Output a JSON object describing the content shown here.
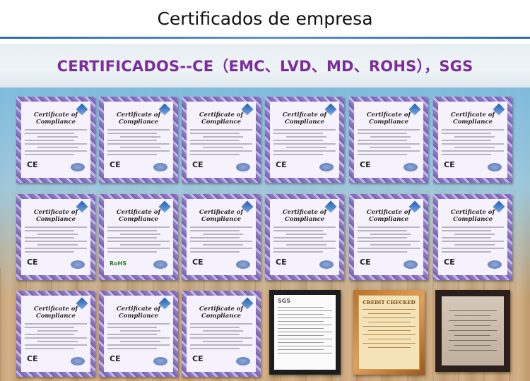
{
  "header": {
    "title": "Certificados de empresa"
  },
  "banner": {
    "text": "CERTIFICADOS--CE（EMC、LVD、MD、ROHS），SGS"
  },
  "certificates": {
    "heading": "Certificate of Compliance",
    "ce_mark": "CE",
    "rohs_mark": "RoHS"
  },
  "framed": {
    "sgs_logo": "SGS",
    "credit_title": "CREDIT CHECKED"
  }
}
